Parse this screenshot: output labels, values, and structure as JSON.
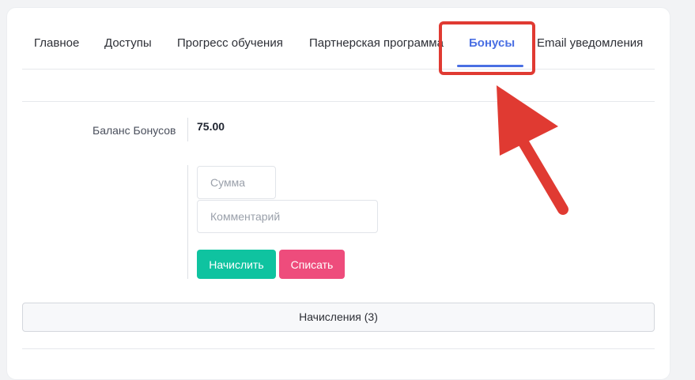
{
  "tabs": [
    {
      "label": "Главное",
      "active": false
    },
    {
      "label": "Доступы",
      "active": false
    },
    {
      "label": "Прогресс обучения",
      "active": false
    },
    {
      "label": "Партнерская программа",
      "active": false
    },
    {
      "label": "Бонусы",
      "active": true
    },
    {
      "label": "Email уведомления",
      "active": false
    }
  ],
  "balance": {
    "label": "Баланс Бонусов",
    "value": "75.00"
  },
  "form": {
    "amount_placeholder": "Сумма",
    "amount_value": "",
    "comment_placeholder": "Комментарий",
    "comment_value": "",
    "accrue_label": "Начислить",
    "withdraw_label": "Списать"
  },
  "accruals": {
    "label": "Начисления (3)"
  },
  "colors": {
    "accent": "#4a6fe3",
    "accrue_button": "#0fc3a0",
    "withdraw_button": "#ee4c7c",
    "annotation": "#e03a32"
  },
  "annotation": {
    "icon": "arrow-pointer-icon",
    "highlight": "highlight-box"
  }
}
